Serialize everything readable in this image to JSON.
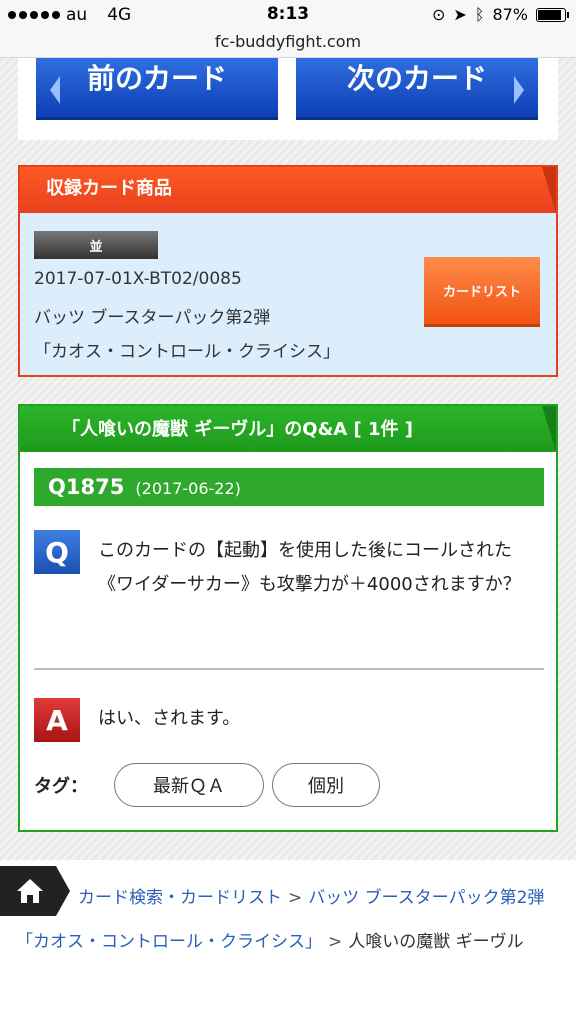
{
  "status_bar": {
    "carrier": "au",
    "network": "4G",
    "time": "8:13",
    "battery": "87%",
    "battery_fraction": 0.87
  },
  "url": "fc-buddyfight.com",
  "nav": {
    "prev_label": "前のカード",
    "next_label": "次のカード"
  },
  "products": {
    "header": "収録カード商品",
    "rarity": "並",
    "card_id": "2017-07-01X-BT02/0085",
    "pack_line1": "バッツ ブースターパック第2弾",
    "pack_line2": "「カオス・コントロール・クライシス」",
    "cardlist_button": "カードリスト"
  },
  "qa": {
    "header": "「人喰いの魔獣 ギーヴル」のQ&A [ 1件 ]",
    "item": {
      "id": "Q1875",
      "date": "(2017-06-22)",
      "q_badge": "Q",
      "question": "このカードの【起動】を使用した後にコールされた《ワイダーサカー》も攻撃力が＋4000されますか？",
      "a_badge": "A",
      "answer": "はい、されます。"
    },
    "tags_label": "タグ：",
    "tags": [
      "最新ＱＡ",
      "個別"
    ]
  },
  "breadcrumb": {
    "items": [
      "カード検索・カードリスト",
      "バッツ ブースターパック第2弾「カオス・コントロール・クライシス」",
      "人喰いの魔獣 ギーヴル"
    ],
    "separator": ">"
  }
}
